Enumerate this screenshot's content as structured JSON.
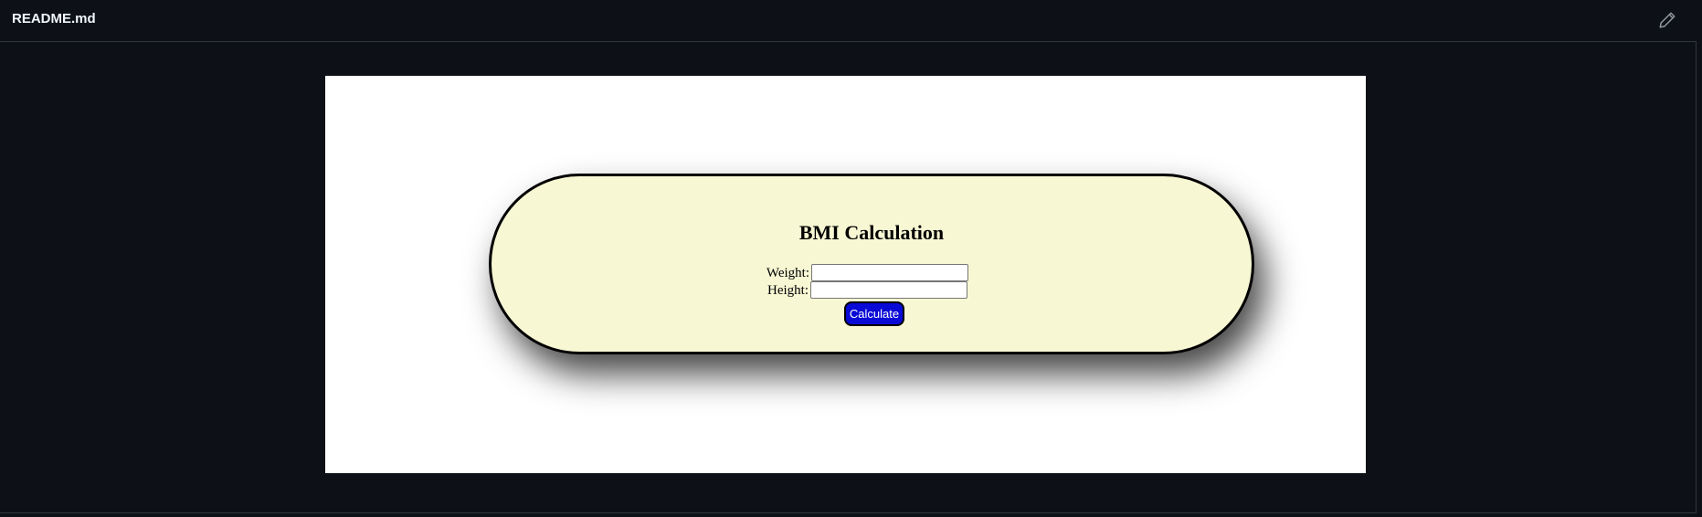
{
  "header": {
    "title": "README.md",
    "edit_icon": "pencil-icon"
  },
  "bmi_form": {
    "title": "BMI Calculation",
    "weight_label": "Weight:",
    "weight_value": "",
    "height_label": "Height:",
    "height_value": "",
    "calculate_label": "Calculate"
  },
  "colors": {
    "page_background": "#0d1117",
    "border": "#30363d",
    "card_background": "#f7f7d4",
    "button_background": "#0a0ad6",
    "button_text": "#ffffff"
  }
}
